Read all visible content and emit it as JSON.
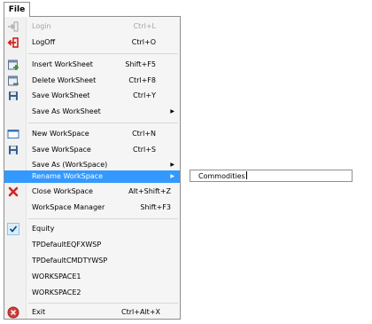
{
  "menubar": {
    "file_label": "File"
  },
  "menu": {
    "login": {
      "label": "Login",
      "shortcut": "Ctrl+L"
    },
    "logoff": {
      "label": "LogOff",
      "shortcut": "Ctrl+O"
    },
    "insert_ws": {
      "label": "Insert WorkSheet",
      "shortcut": "Shift+F5"
    },
    "delete_ws": {
      "label": "Delete WorkSheet",
      "shortcut": "Ctrl+F8"
    },
    "save_ws": {
      "label": "Save WorkSheet",
      "shortcut": "Ctrl+Y"
    },
    "save_as_ws": {
      "label": "Save As WorkSheet"
    },
    "new_wsp": {
      "label": "New WorkSpace",
      "shortcut": "Ctrl+N"
    },
    "save_wsp": {
      "label": "Save WorkSpace",
      "shortcut": "Ctrl+S"
    },
    "save_as_wsp": {
      "label": "Save As (WorkSpace)"
    },
    "rename_wsp": {
      "label": "Rename WorkSpace"
    },
    "close_wsp": {
      "label": "Close WorkSpace",
      "shortcut": "Alt+Shift+Z"
    },
    "wsp_manager": {
      "label": "WorkSpace Manager",
      "shortcut": "Shift+F3"
    },
    "workspaces": [
      "Equity",
      "TPDefaultEQFXWSP",
      "TPDefaultCMDTYWSP",
      "WORKSPACE1",
      "WORKSPACE2"
    ],
    "exit": {
      "label": "Exit",
      "shortcut": "Ctrl+Alt+X"
    }
  },
  "submenu": {
    "rename_value": "Commodities"
  },
  "colors": {
    "highlight": "#3399ff",
    "border": "#8f8f8f",
    "disabled_text": "#a4a4a4"
  },
  "icons": {
    "login": "login-icon",
    "logoff": "logoff-icon",
    "insert": "insert-worksheet-icon",
    "delete": "delete-worksheet-icon",
    "save": "save-icon",
    "new": "new-workspace-icon",
    "close": "close-icon",
    "check": "checkmark-icon",
    "exit": "exit-icon"
  }
}
